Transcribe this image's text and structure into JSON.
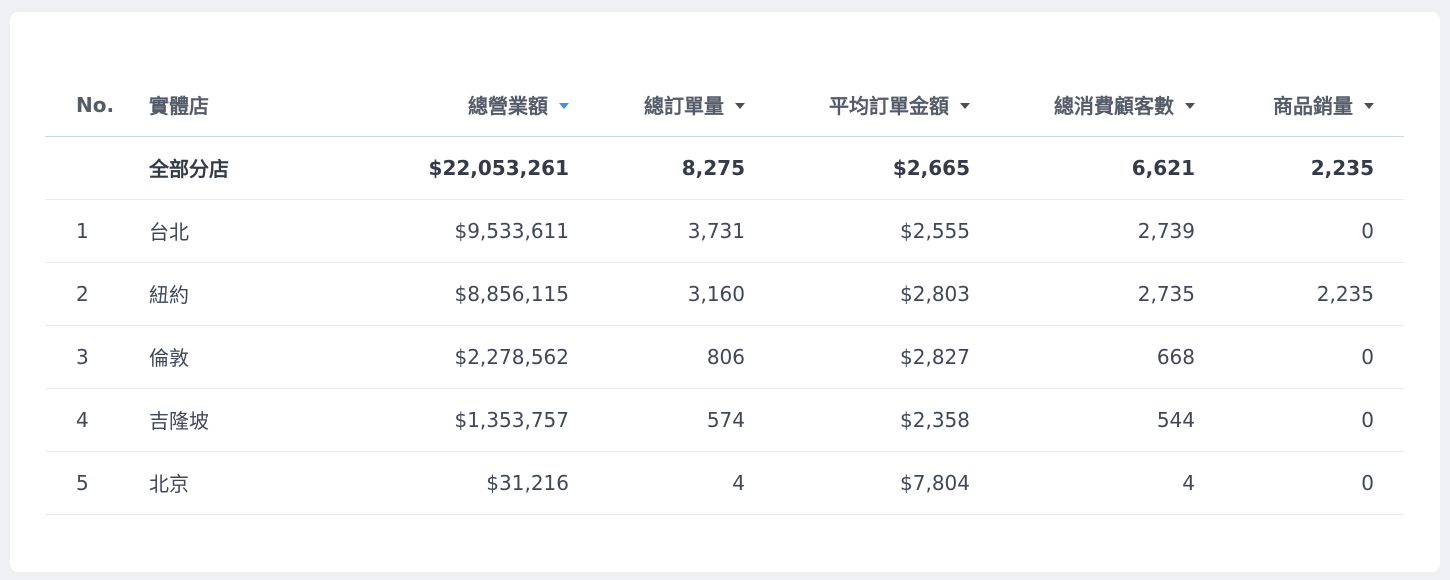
{
  "table": {
    "headers": {
      "no": "No.",
      "store": "實體店",
      "revenue": "總營業額",
      "orders": "總訂單量",
      "avg_order": "平均訂單金額",
      "customers": "總消費顧客數",
      "units": "商品銷量"
    },
    "sort": {
      "column": "revenue",
      "direction": "desc",
      "active_color": "#3d8ff0"
    },
    "total": {
      "store": "全部分店",
      "revenue": "$22,053,261",
      "orders": "8,275",
      "avg_order": "$2,665",
      "customers": "6,621",
      "units": "2,235"
    },
    "rows": [
      {
        "no": "1",
        "store": "台北",
        "revenue": "$9,533,611",
        "orders": "3,731",
        "avg_order": "$2,555",
        "customers": "2,739",
        "units": "0"
      },
      {
        "no": "2",
        "store": "紐約",
        "revenue": "$8,856,115",
        "orders": "3,160",
        "avg_order": "$2,803",
        "customers": "2,735",
        "units": "2,235"
      },
      {
        "no": "3",
        "store": "倫敦",
        "revenue": "$2,278,562",
        "orders": "806",
        "avg_order": "$2,827",
        "customers": "668",
        "units": "0"
      },
      {
        "no": "4",
        "store": "吉隆坡",
        "revenue": "$1,353,757",
        "orders": "574",
        "avg_order": "$2,358",
        "customers": "544",
        "units": "0"
      },
      {
        "no": "5",
        "store": "北京",
        "revenue": "$31,216",
        "orders": "4",
        "avg_order": "$7,804",
        "customers": "4",
        "units": "0"
      }
    ]
  }
}
